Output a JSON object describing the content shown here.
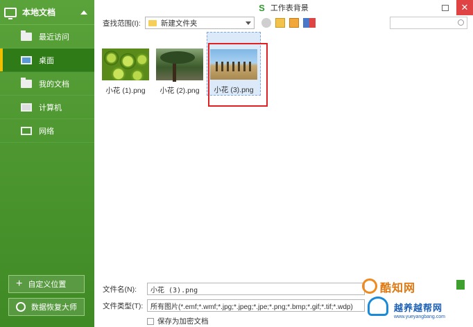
{
  "sidebar": {
    "header": "本地文档",
    "items": [
      {
        "label": "最近访问",
        "icon": "recent-folder-icon"
      },
      {
        "label": "桌面",
        "icon": "desktop-icon",
        "active": true
      },
      {
        "label": "我的文档",
        "icon": "folder-icon"
      },
      {
        "label": "计算机",
        "icon": "computer-icon"
      },
      {
        "label": "网络",
        "icon": "network-icon"
      }
    ],
    "custom_location": "自定义位置",
    "recovery": "数据恢复大师"
  },
  "window": {
    "logo": "S",
    "title": "工作表背景"
  },
  "toolbar": {
    "lookin_label": "查找范围(I):",
    "lookin_value": "新建文件夹"
  },
  "files": [
    {
      "name": "小花 (1).png",
      "thumb": "kiwi"
    },
    {
      "name": "小花 (2).png",
      "thumb": "tree"
    },
    {
      "name": "小花 (3).png",
      "thumb": "desert",
      "selected": true
    }
  ],
  "form": {
    "filename_label": "文件名(N):",
    "filename_value": "小花 (3).png",
    "filetype_label": "文件类型(T):",
    "filetype_value": "所有图片(*.emf;*.wmf;*.jpg;*.jpeg;*.jpe;*.png;*.bmp;*.gif;*.tif;*.wdp)",
    "save_encrypted": "保存为加密文档"
  },
  "watermark": {
    "brand1": "酷知网",
    "brand2": "越养越帮网",
    "url": "www.yueyangbang.com"
  },
  "colors": {
    "sidebar_green": "#4a9630",
    "active_marker": "#f0c000",
    "highlight_red": "#e02020",
    "close_red": "#e04343"
  }
}
